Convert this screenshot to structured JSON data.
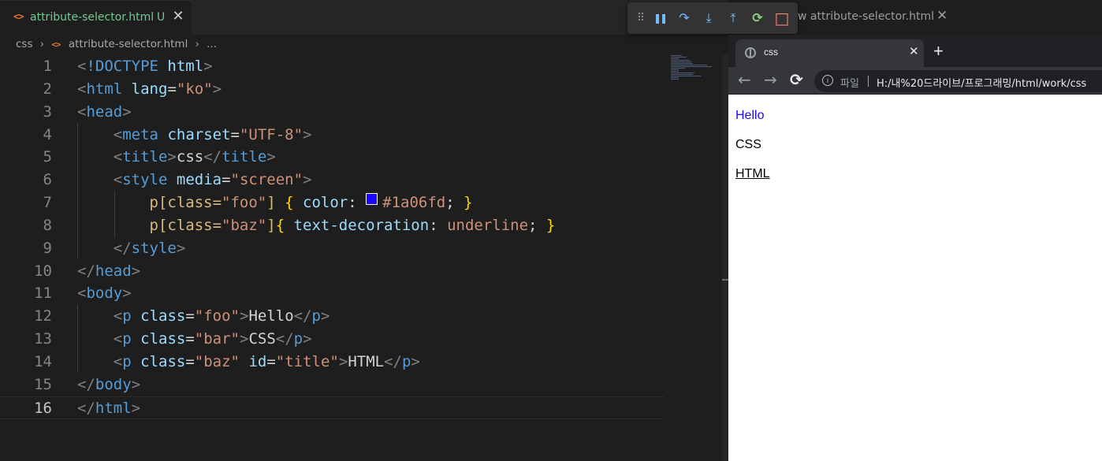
{
  "editor": {
    "tab": {
      "icon": "html-file-icon",
      "filename": "attribute-selector.html",
      "status": "U",
      "close": "✕"
    },
    "preview_tab": {
      "label_partial": "w attribute-selector.html",
      "close": "✕"
    },
    "breadcrumb": {
      "folder": "css",
      "file": "attribute-selector.html",
      "more": "..."
    },
    "current_line": 16,
    "swatch_color": "#1a06fd"
  },
  "debug_toolbar": {
    "grip": "⠿",
    "pause": "❚❚",
    "step_over": "↷",
    "step_into": "⤓",
    "step_out": "⤒",
    "restart": "⟳",
    "stop": "□",
    "colors": {
      "icons": "#75beff",
      "restart": "#89d185",
      "stop": "#f48771"
    }
  },
  "browser": {
    "tab_title": "css",
    "tab_close": "✕",
    "new_tab": "+",
    "back": "←",
    "forward": "→",
    "reload": "⟳",
    "info": "i",
    "scheme_label": "파일",
    "url": "H:/내%20드라이브/프로그래밍/html/work/css",
    "paragraphs": {
      "foo": "Hello",
      "bar": "CSS",
      "baz": "HTML"
    },
    "colors": {
      "foo": "#1a06fd"
    }
  }
}
